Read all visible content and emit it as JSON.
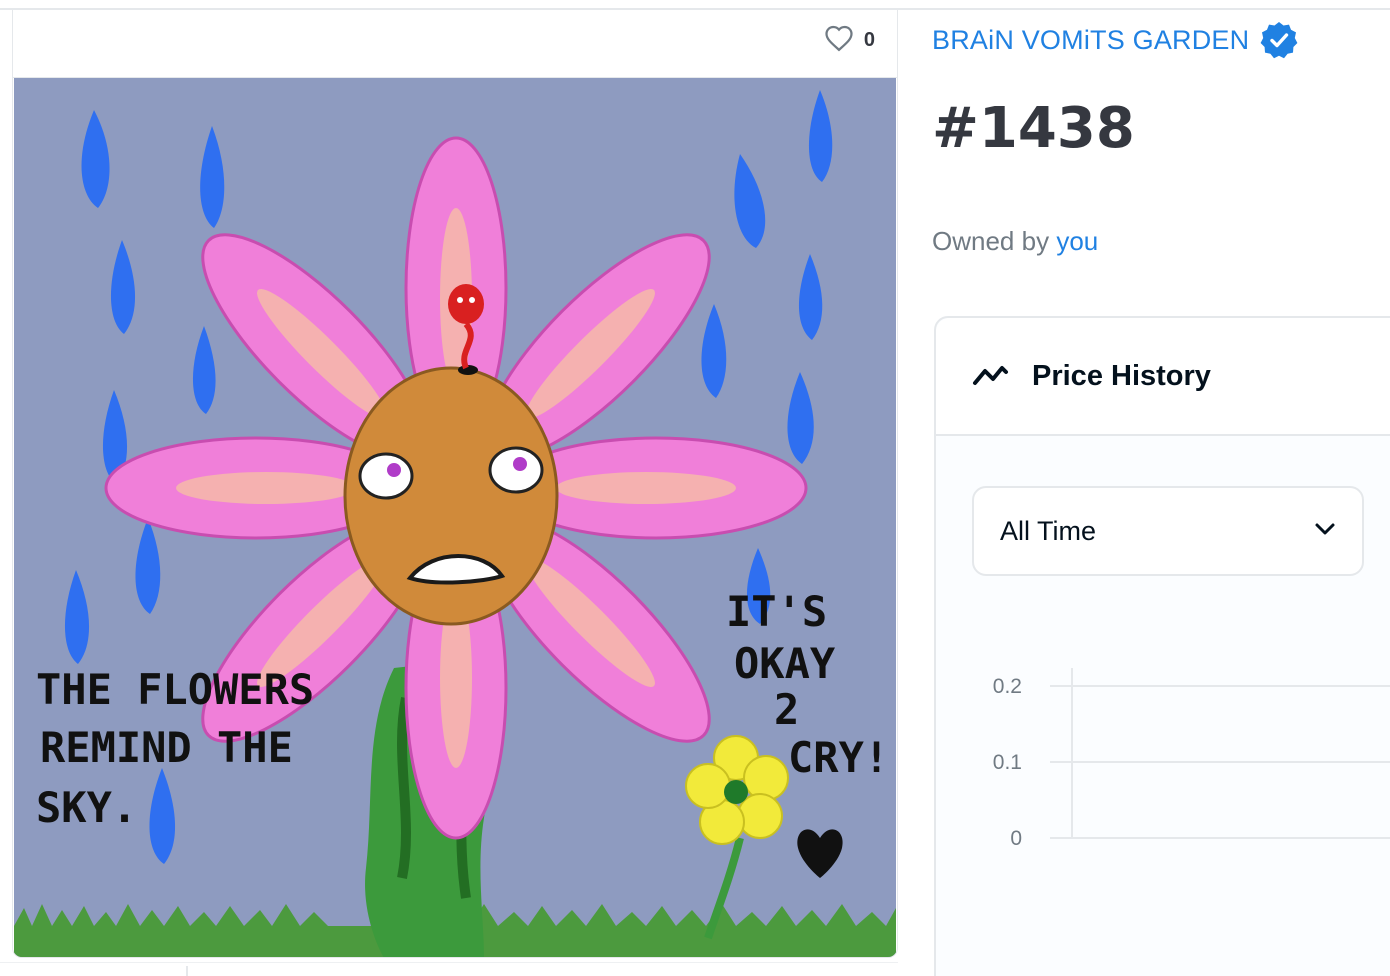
{
  "media": {
    "favorite_icon": "heart-outline-icon",
    "favorite_count": "0",
    "artwork": {
      "text_left": [
        "THE FLOWERS",
        "REMIND THE",
        "SKY."
      ],
      "text_right": [
        "IT'S",
        "OKAY",
        "2",
        "CRY!"
      ],
      "colors": {
        "background": "#8e9bc0",
        "petal": "#f07fd9",
        "center": "#d08a3a",
        "raindrop": "#2f6ff0",
        "stem": "#3c9a3c"
      }
    }
  },
  "collection": {
    "name": "BRAiN VOMiTS GARDEN",
    "verified_icon": "verified-badge-icon"
  },
  "item": {
    "title": "#1438"
  },
  "ownership": {
    "prefix": "Owned by",
    "owner": "you"
  },
  "price_history": {
    "title": "Price History",
    "icon": "trend-line-icon",
    "range_select": {
      "value": "All Time",
      "icon": "chevron-down-icon"
    }
  },
  "chart_data": {
    "type": "line",
    "title": "",
    "xlabel": "",
    "ylabel": "",
    "y_ticks": [
      "0.2",
      "0.1",
      "0"
    ],
    "ylim": [
      0,
      0.2
    ],
    "series": [],
    "grid": true
  },
  "colors": {
    "accent": "#2081e2",
    "text_dark": "#04111d",
    "text_muted": "#707a83",
    "border": "#e5e8eb"
  }
}
